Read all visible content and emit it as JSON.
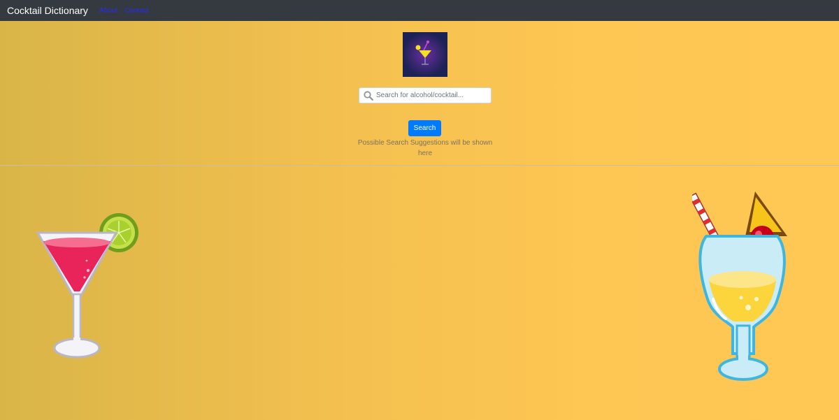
{
  "navbar": {
    "brand": "Cocktail Dictionary",
    "links": [
      {
        "label": "About"
      },
      {
        "label": "Contact"
      }
    ]
  },
  "search": {
    "placeholder": "Search for alcohol/cocktail...",
    "value": "",
    "button_label": "Search"
  },
  "suggestions": {
    "text": "Possible Search Suggestions will be shown here"
  },
  "icons": {
    "search": "search-icon",
    "logo": "cocktail-logo",
    "left_illustration": "martini-glass-icon",
    "right_illustration": "hurricane-cocktail-icon"
  },
  "colors": {
    "navbar": "#343a40",
    "accent": "#007bff",
    "background": "#fec653",
    "link": "#2a2af5"
  }
}
